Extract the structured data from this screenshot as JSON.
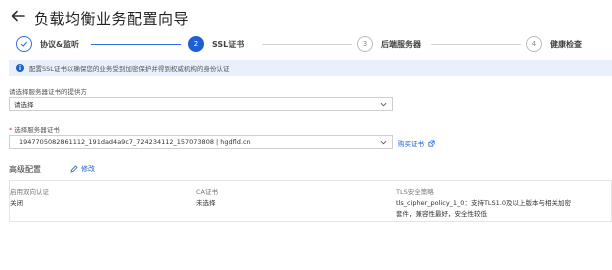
{
  "header": {
    "title": "负载均衡业务配置向导"
  },
  "steps": [
    {
      "number": "✓",
      "label": "协议&监听",
      "state": "done"
    },
    {
      "number": "2",
      "label": "SSL证书",
      "state": "active"
    },
    {
      "number": "3",
      "label": "后端服务器",
      "state": "pending"
    },
    {
      "number": "4",
      "label": "健康检查",
      "state": "pending"
    }
  ],
  "banner": {
    "text": "配置SSL证书以确保您的业务受到加密保护并得到权威机构的身份认证"
  },
  "ca_source": {
    "label": "请选择服务器证书的提供方",
    "value": "请选择"
  },
  "server_cert": {
    "label": "选择服务器证书",
    "value": "1947705082861112_191dad4a9c7_724234112_157073808 | hgdfld.cn",
    "buy_link": "购买证书"
  },
  "advanced": {
    "title": "高级配置",
    "edit_label": "修改",
    "columns": [
      {
        "label": "启用双向认证",
        "value": "关闭"
      },
      {
        "label": "CA证书",
        "value": "未选择"
      },
      {
        "label": "TLS安全策略",
        "value": "tls_cipher_policy_1_0：支持TLS1.0及以上版本与相关加密",
        "value2": "套件，兼容性最好，安全性较低"
      }
    ]
  }
}
